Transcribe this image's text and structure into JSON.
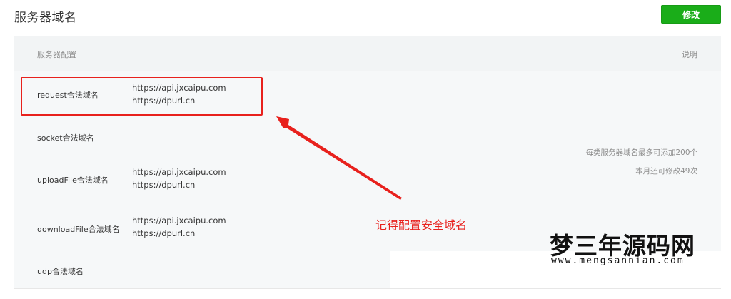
{
  "header": {
    "title": "服务器域名",
    "modify_label": "修改"
  },
  "table": {
    "col_config": "服务器配置",
    "col_desc": "说明",
    "rows": [
      {
        "label": "request合法域名",
        "values": [
          "https://api.jxcaipu.com",
          "https://dpurl.cn"
        ]
      },
      {
        "label": "socket合法域名",
        "values": []
      },
      {
        "label": "uploadFile合法域名",
        "values": [
          "https://api.jxcaipu.com",
          "https://dpurl.cn"
        ]
      },
      {
        "label": "downloadFile合法域名",
        "values": [
          "https://api.jxcaipu.com",
          "https://dpurl.cn"
        ]
      },
      {
        "label": "udp合法域名",
        "values": []
      }
    ],
    "description": [
      "每类服务器域名最多可添加200个",
      "本月还可修改49次"
    ]
  },
  "annotation": {
    "text": "记得配置安全域名",
    "color": "#e8211d"
  },
  "watermark": {
    "title": "梦三年源码网",
    "url": "www.mengsannian.com"
  },
  "colors": {
    "primary_button": "#1aad19",
    "highlight": "#e8211d"
  }
}
